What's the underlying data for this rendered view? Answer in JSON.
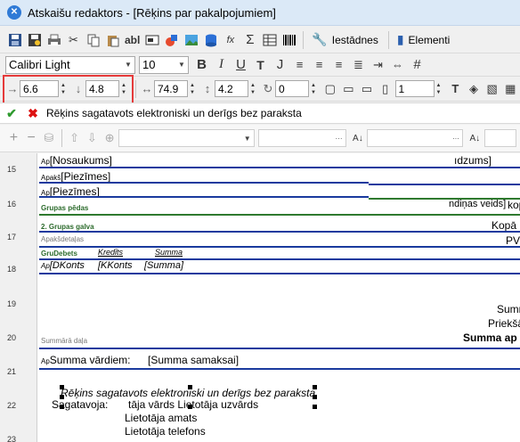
{
  "window": {
    "title": "Atskaišu redaktors - [Rēķins par pakalpojumiem]"
  },
  "toolbar1": {
    "icons": [
      "save-icon",
      "save-as-icon",
      "print-icon",
      "cut-icon",
      "copy-icon",
      "paste-icon",
      "label-icon",
      "field-icon",
      "shape-icon",
      "image-icon",
      "database-icon",
      "formula-icon",
      "sum-icon",
      "table-icon",
      "barcode-icon"
    ],
    "label_btn": "abl",
    "settings_label": "Iestādnes",
    "elements_label": "Elementi"
  },
  "toolbar2": {
    "font_family": "Calibri Light",
    "font_size": "10",
    "bold": "B",
    "italic": "I",
    "underline": "U",
    "tt": "T",
    "justify": "J"
  },
  "toolbar3": {
    "left": "6.6",
    "top": "4.8",
    "width": "74.9",
    "height": "4.2",
    "rotation": "0",
    "border_width": "1"
  },
  "formula": {
    "text": "Rēķins sagatavots elektroniski un derīgs bez paraksta"
  },
  "toolbar5": {
    "plus": "+",
    "minus": "−"
  },
  "ruler": {
    "numbers": [
      "15",
      "16",
      "17",
      "18",
      "19",
      "20",
      "21",
      "22",
      "23"
    ]
  },
  "report": {
    "nosaukums": "[Nosaukums]",
    "nosaukums_prefix": "Ap",
    "right_dzums": "ıdzums]",
    "piezimes1": "[Piezīmes]",
    "piezimes1_prefix": "Apakš",
    "piezimes2": "[Piezīmes]",
    "piezimes2_prefix": "Ap",
    "grupas_pedas": "Grupas pēdas",
    "maksasanas": "ndiņas veids]",
    "kop": "kop",
    "grupas_galva": "2. Grupas galva",
    "kopa": "Kopā",
    "apakdetalas": "Apakšdetaļas",
    "pv": "PV",
    "gru_debets": "GruDebets",
    "kredits": "Kredīts",
    "summa_hdr": "Summa",
    "dkonts_prefix": "Ap",
    "dkonts": "[DKonts",
    "kkonts": "[KKonts",
    "summa_field": "[Summa]",
    "summ_right": "Summ",
    "prieksa": "Priekšā",
    "summa_ap": "Summa ap",
    "summaras_dala": "Summārā daļa",
    "summa_vardiem_prefix": "Ap",
    "summa_vardiem": "Summa vārdiem:",
    "summa_samaksai": "[Summa samaksai]",
    "selected_text": "Rēķins sagatavots elektroniski un derīgs bez paraksta",
    "sagatavoja": "Sagatavoja:",
    "user_name": "tāja vārds Lietotāja uzvārds",
    "user_position": "Lietotāja amats",
    "user_phone": "Lietotāja telefons"
  }
}
